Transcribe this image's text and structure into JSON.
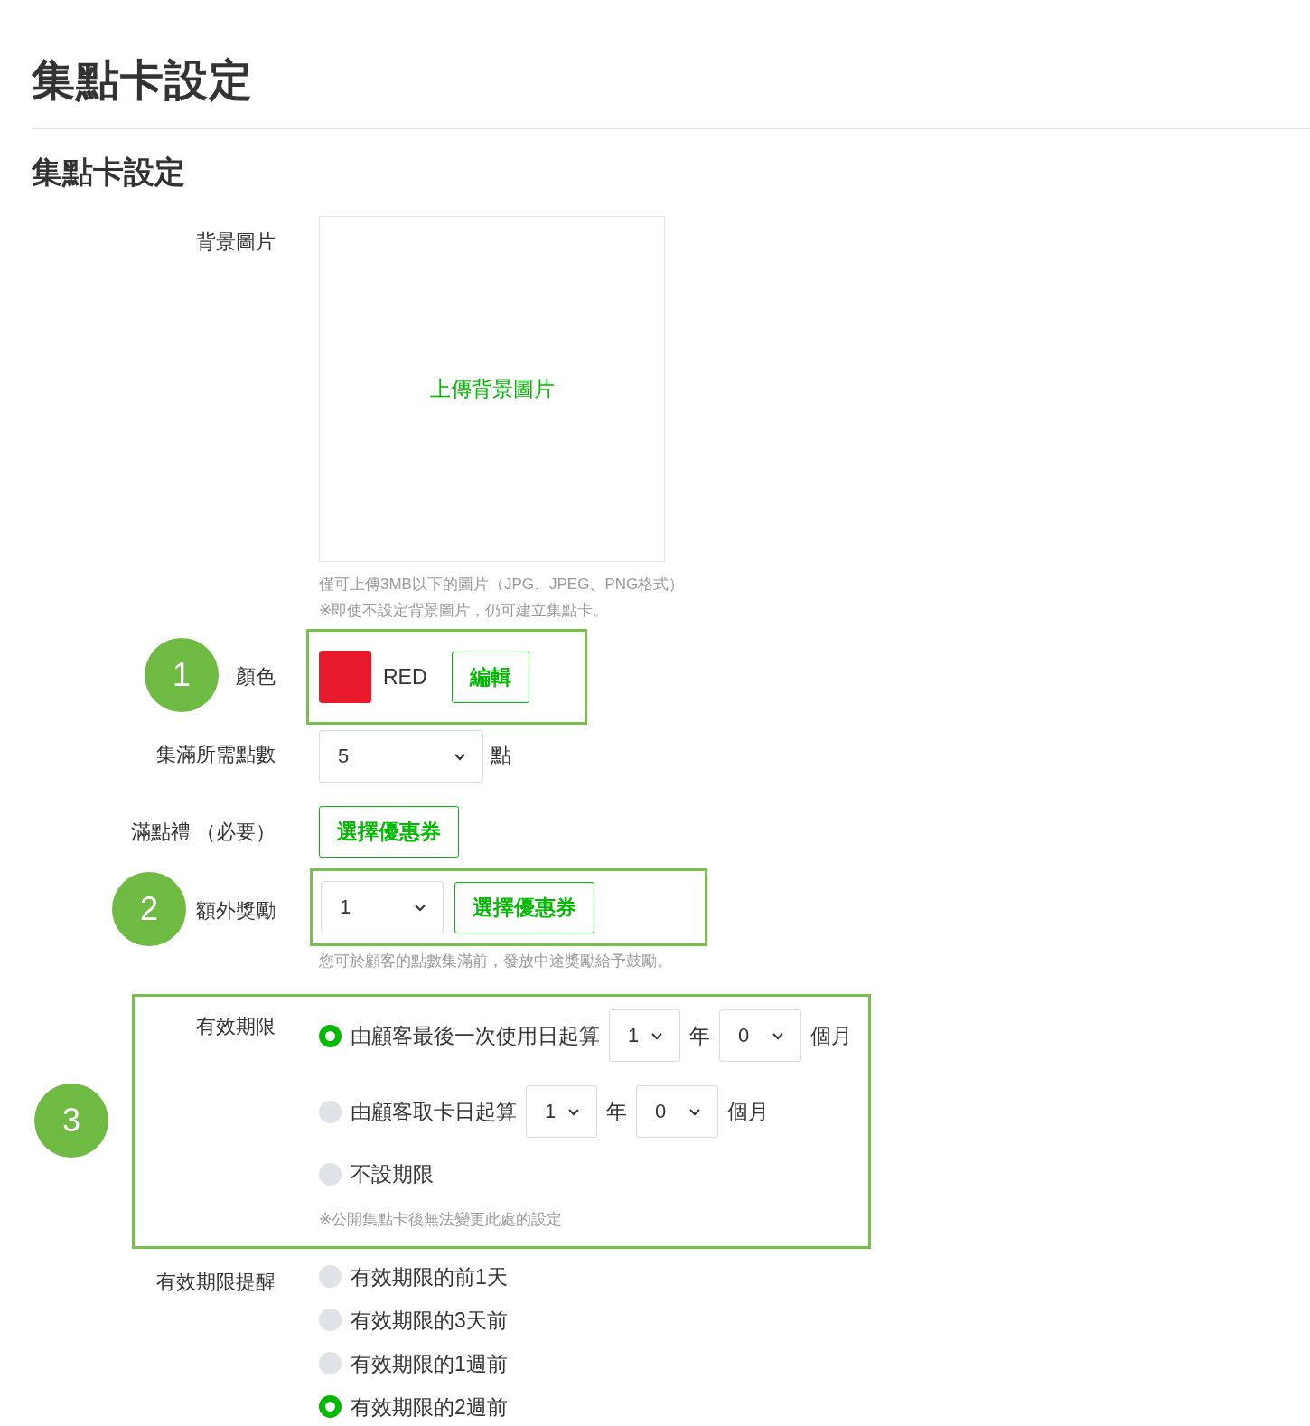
{
  "page_title": "集點卡設定",
  "section_title": "集點卡設定",
  "background_image": {
    "label": "背景圖片",
    "upload_link": "上傳背景圖片",
    "notes": [
      "僅可上傳3MB以下的圖片（JPG、JPEG、PNG格式）",
      "※即使不設定背景圖片，仍可建立集點卡。"
    ]
  },
  "color": {
    "label": "顏色",
    "swatch": {
      "color": "#e8192c"
    },
    "name": "RED",
    "edit_button": "編輯"
  },
  "points_required": {
    "label": "集滿所需點數",
    "value": "5",
    "unit": "點"
  },
  "full_reward": {
    "label": "滿點禮 （必要）",
    "button": "選擇優惠券"
  },
  "extra_reward": {
    "label": "額外獎勵",
    "value": "1",
    "button": "選擇優惠券",
    "note": "您可於顧客的點數集滿前，發放中途獎勵給予鼓勵。"
  },
  "validity": {
    "label": "有效期限",
    "options": [
      {
        "kind": "period",
        "label": "由顧客最後一次使用日起算",
        "selected": true,
        "years": "1",
        "year_unit": "年",
        "months": "0",
        "month_unit": "個月"
      },
      {
        "kind": "period",
        "label": "由顧客取卡日起算",
        "selected": false,
        "years": "1",
        "year_unit": "年",
        "months": "0",
        "month_unit": "個月"
      },
      {
        "kind": "plain",
        "label": "不設期限",
        "selected": false
      }
    ],
    "note": "※公開集點卡後無法變更此處的設定"
  },
  "reminder": {
    "label": "有效期限提醒",
    "options": [
      {
        "label": "有效期限的前1天",
        "selected": false
      },
      {
        "label": "有效期限的3天前",
        "selected": false
      },
      {
        "label": "有效期限的1週前",
        "selected": false
      },
      {
        "label": "有效期限的2週前",
        "selected": true
      }
    ]
  },
  "annotations": [
    {
      "number": "1"
    },
    {
      "number": "2"
    },
    {
      "number": "3"
    }
  ]
}
